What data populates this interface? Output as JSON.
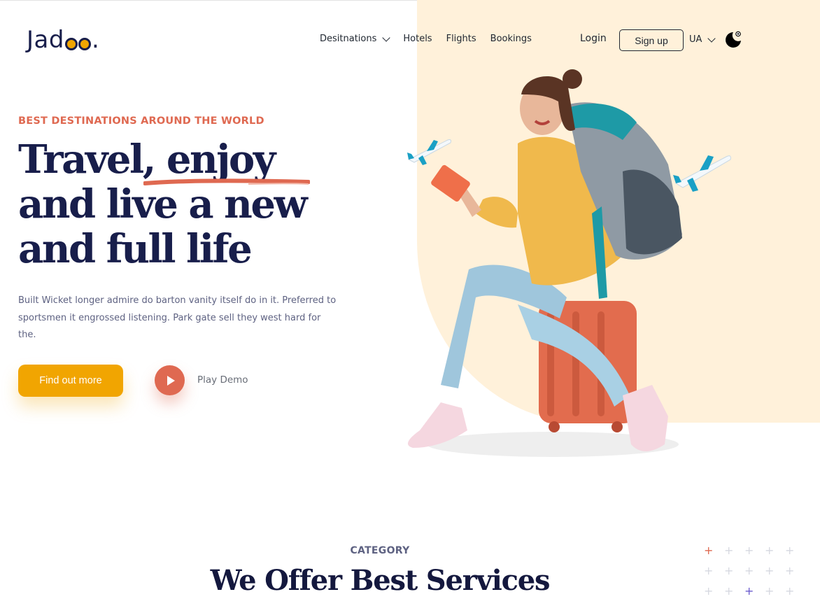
{
  "brand": {
    "logo_text_a": "Jad",
    "logo_text_b": "."
  },
  "nav": {
    "items": [
      {
        "label": "Desitnations",
        "has_dropdown": true
      },
      {
        "label": "Hotels"
      },
      {
        "label": "Flights"
      },
      {
        "label": "Bookings"
      }
    ],
    "login_label": "Login",
    "signup_label": "Sign up",
    "language": "UA"
  },
  "hero": {
    "eyebrow": "BEST DESTINATIONS AROUND THE WORLD",
    "title_lines": [
      "Travel, enjoy",
      "and live a new",
      "and full life"
    ],
    "description": "Built Wicket longer admire do barton vanity itself do in it. Preferred to sportsmen it engrossed listening. Park gate sell they west hard for the.",
    "cta_label": "Find out more",
    "play_label": "Play Demo"
  },
  "category": {
    "eyebrow": "CATEGORY",
    "title": "We Offer Best Services"
  },
  "colors": {
    "accent": "#f1a501",
    "coral": "#df6951",
    "navy": "#181e4b",
    "blob": "#fff1da"
  },
  "icons": [
    "chevron-down-icon",
    "moon-icon",
    "play-icon",
    "airplane-icon",
    "plus-icon"
  ]
}
